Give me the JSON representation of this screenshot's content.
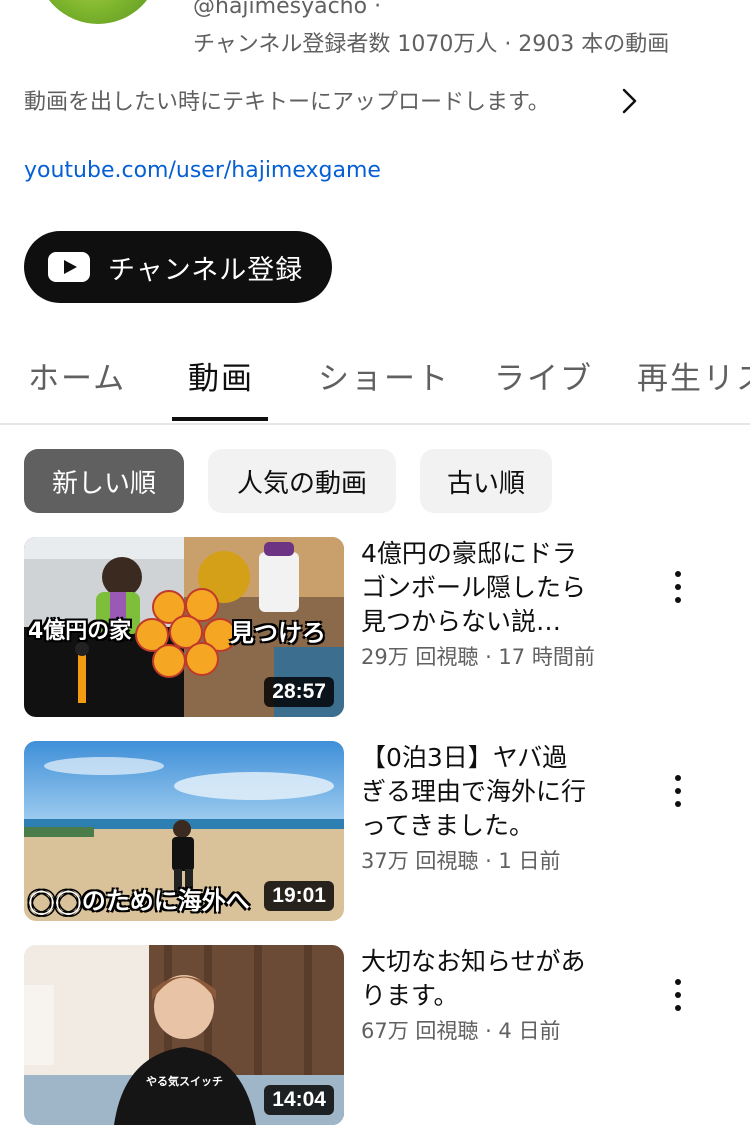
{
  "channel": {
    "handle_line": "@hajimesyacho ·",
    "stats": "チャンネル登録者数 1070万人 · 2903 本の動画",
    "description": "動画を出したい時にテキトーにアップロードします。",
    "link": "youtube.com/user/hajimexgame",
    "subscribe_label": "チャンネル登録"
  },
  "tabs": [
    {
      "label": "ホーム"
    },
    {
      "label": "動画"
    },
    {
      "label": "ショート"
    },
    {
      "label": "ライブ"
    },
    {
      "label": "再生リス"
    }
  ],
  "active_tab": "動画",
  "chips": [
    {
      "label": "新しい順"
    },
    {
      "label": "人気の動画"
    },
    {
      "label": "古い順"
    }
  ],
  "selected_chip": "新しい順",
  "videos": [
    {
      "title_lines": [
        "4億円の豪邸にドラ",
        "ゴンボール隠したら",
        "見つからない説…"
      ],
      "meta": "29万 回視聴 · 17 時間前",
      "duration": "28:57",
      "thumb_text_left": "4億円の家",
      "thumb_text_right": "見つけろ"
    },
    {
      "title_lines": [
        "【0泊3日】ヤバ過",
        "ぎる理由で海外に行",
        "ってきました。"
      ],
      "meta": "37万 回視聴 · 1 日前",
      "duration": "19:01",
      "thumb_text": "◯◯のために海外へ"
    },
    {
      "title_lines": [
        "大切なお知らせがあ",
        "ります。"
      ],
      "meta": "67万 回視聴 · 4 日前",
      "duration": "14:04",
      "shirt_text": "やる気スイッチ"
    }
  ],
  "icons": {
    "chevron": "chevron-right-icon",
    "youtube": "youtube-logo-icon",
    "more": "more-vert-icon"
  },
  "colors": {
    "link": "#065fd4",
    "subscribe_bg": "#0f0f0f",
    "chip_selected": "#606060",
    "chip": "#f2f2f2"
  }
}
